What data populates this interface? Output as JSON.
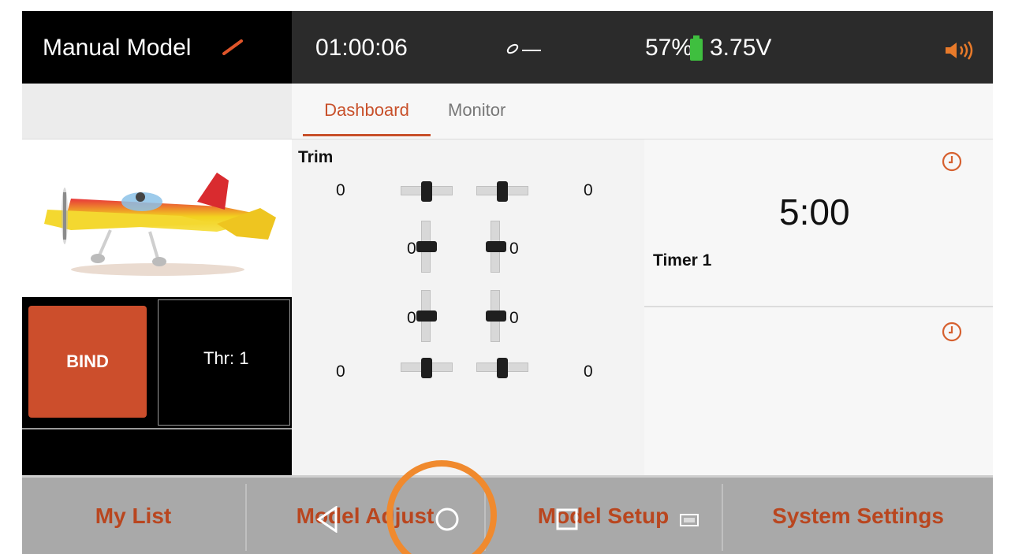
{
  "header": {
    "model_name": "Manual Model",
    "timer": "01:00:06",
    "battery_percent": "57%",
    "voltage": "3.75V"
  },
  "tabs": [
    {
      "label": "Dashboard",
      "active": true
    },
    {
      "label": "Monitor",
      "active": false
    }
  ],
  "left_panel": {
    "bind_label": "BIND",
    "throttle_label": "Thr: 1"
  },
  "trim": {
    "title": "Trim",
    "top_left": "0",
    "top_right": "0",
    "upper_mid_left": "0",
    "upper_mid_right": "0",
    "lower_mid_left": "0",
    "lower_mid_right": "0",
    "bottom_left": "0",
    "bottom_right": "0"
  },
  "timers": {
    "timer1_value": "5:00",
    "timer1_label": "Timer 1"
  },
  "bottom_nav": {
    "my_list": "My List",
    "model_adjust": "Model Adjust",
    "model_setup": "Model Setup",
    "system_settings": "System Settings"
  },
  "colors": {
    "accent": "#c8502a",
    "highlight_circle": "#f08a2e"
  }
}
